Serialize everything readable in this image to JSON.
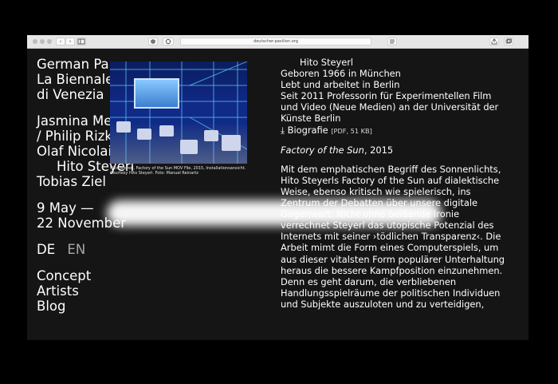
{
  "browser": {
    "url": "deutscher-pavilion.org",
    "nav_back": "‹",
    "nav_forward": "›"
  },
  "site": {
    "title_lines": [
      "German Pa",
      "La Biennale",
      "di Venezia"
    ],
    "artists_block": [
      "Jasmina Me",
      "/ Philip Rizk",
      "Olaf Nicolai",
      "Hito Steyerl",
      "Tobias Ziel"
    ],
    "dates": [
      "9 May —",
      "22 November"
    ],
    "lang": {
      "de": "DE",
      "en": "EN"
    },
    "menu": [
      "Concept",
      "Artists",
      "Blog"
    ]
  },
  "image": {
    "caption": "Hito Steyerl, Factory of the Sun MOV File, 2015, Installationsansicht. Courtesy Hito Steyerl. Foto: Manuel Reinartz"
  },
  "artist": {
    "name": "Hito Steyerl",
    "bio": [
      "Geboren 1966 in München",
      "Lebt und arbeitet in Berlin",
      "Seit 2011 Professorin für Experimentellen Film",
      "und Video (Neue Medien) an der Universität der",
      "Künste Berlin"
    ],
    "bio_link": "⤓ Biografie",
    "bio_file": "[PDF, 51 KB]",
    "work_title": "Factory of the Sun",
    "work_year": ", 2015",
    "body_lines": [
      "Mit dem emphatischen Begriff des Sonnenlichts,",
      "Hito Steyerls Factory of the Sun auf dialektische",
      "Weise, ebenso kritisch wie spielerisch, ins",
      "Zentrum der Debatten über unsere digitale",
      "Gegenwart. Nicht ohne beißende Ironie",
      "verrechnet Steyerl das utopische Potenzial des",
      "Internets mit seiner ›tödlichen Transparenz‹. Die",
      "Arbeit mimt die Form eines Computerspiels, um",
      "aus dieser vitalsten Form populärer Unterhaltung",
      "heraus die bessere Kampfposition einzunehmen.",
      "Denn es geht darum, die verbliebenen",
      "Handlungsspielräume der politischen Individuen",
      "und Subjekte auszuloten und zu verteidigen,"
    ]
  }
}
